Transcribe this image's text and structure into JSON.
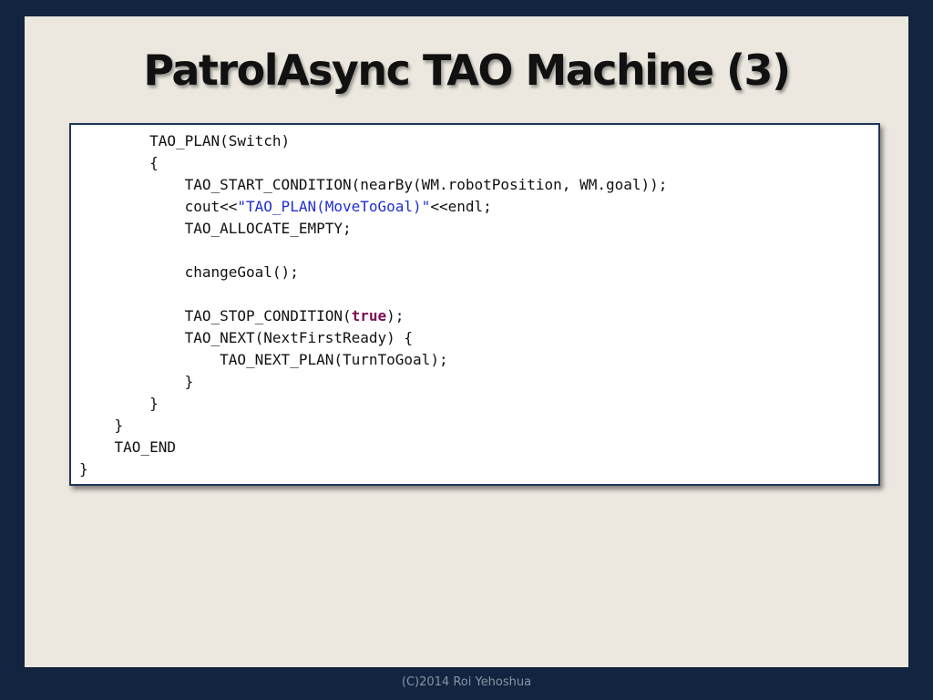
{
  "slide": {
    "title": "PatrolAsync TAO Machine (3)",
    "footer": "(C)2014 Roi Yehoshua"
  },
  "code": {
    "lines": [
      {
        "indent": "        ",
        "text": "TAO_PLAN(Switch)"
      },
      {
        "indent": "        ",
        "text": "{"
      },
      {
        "indent": "            ",
        "text": "TAO_START_CONDITION(nearBy(WM.robotPosition, WM.goal));"
      },
      {
        "indent": "            ",
        "pre": "cout<<",
        "string": "\"TAO_PLAN(MoveToGoal)\"",
        "post": "<<endl;"
      },
      {
        "indent": "            ",
        "text": "TAO_ALLOCATE_EMPTY;"
      },
      {
        "indent": "",
        "text": ""
      },
      {
        "indent": "            ",
        "text": "changeGoal();"
      },
      {
        "indent": "",
        "text": ""
      },
      {
        "indent": "            ",
        "pre": "TAO_STOP_CONDITION(",
        "keyword": "true",
        "post": ");"
      },
      {
        "indent": "            ",
        "text": "TAO_NEXT(NextFirstReady) {"
      },
      {
        "indent": "                ",
        "text": "TAO_NEXT_PLAN(TurnToGoal);"
      },
      {
        "indent": "            ",
        "text": "}"
      },
      {
        "indent": "        ",
        "text": "}"
      },
      {
        "indent": "    ",
        "text": "}"
      },
      {
        "indent": "    ",
        "text": "TAO_END"
      },
      {
        "indent": "",
        "text": "}"
      }
    ]
  },
  "colors": {
    "background": "#12243f",
    "slide": "#ece8df",
    "string": "#1f2fd1",
    "keyword": "#7b0c55"
  }
}
